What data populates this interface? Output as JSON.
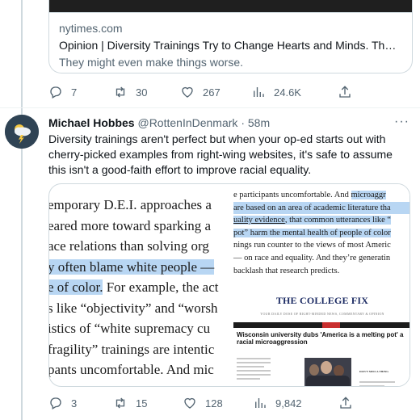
{
  "tweet1": {
    "card": {
      "domain": "nytimes.com",
      "title": "Opinion | Diversity Trainings Try to Change Hearts and Minds. That's a…",
      "description": "They might even make things worse."
    },
    "actions": {
      "replies": "7",
      "retweets": "30",
      "likes": "267",
      "views": "24.6K"
    }
  },
  "tweet2": {
    "author": {
      "name": "Michael Hobbes",
      "handle": "@RottenInDenmark",
      "separator": "·",
      "time": "58m"
    },
    "more_label": "···",
    "text": "Diversity trainings aren't perfect but when your op-ed starts out with cherry-picked examples from right-wing websites, it's safe to assume this isn't a good-faith effort to improve racial equality.",
    "media_left": {
      "lines": [
        "emporary D.E.I. approaches a",
        "eared more toward sparking a",
        "ace relations than solving org",
        "y often blame white people —",
        "e of color. For example, the act",
        "s like “objectivity” and “worsh",
        "istics of “white supremacy cu",
        "fragility” trainings are intentic",
        "pants uncomfortable. And mic"
      ],
      "highlight_line3": "y often blame white people —",
      "highlight_line4": "e of color."
    },
    "media_right": {
      "line1_a": "e participants uncomfortable. And ",
      "line1_b": "microaggr",
      "line2": "are based on an area of academic literature tha",
      "line3_a": "uality evidence",
      "line3_b": ", that common utterances like “",
      "line4_a": "pot”",
      "line4_b": " harm the mental health of people of color",
      "line5": "nings run counter to the views of most Americ",
      "line6": "— on race and equality. And they’re generatin",
      "line7": "backlash that research predicts.",
      "screenshot": {
        "logo": "THE COLLEGE FIX",
        "tagline": "YOUR DAILY DOSE OF RIGHT-MINDED NEWS, COMMENTARY & OPINION",
        "title": "Wisconsin university dubs 'America is a melting pot' a racial microaggression",
        "side_title": "DON'T MISS A THING"
      }
    },
    "actions": {
      "replies": "3",
      "retweets": "15",
      "likes": "128",
      "views": "9,842"
    }
  }
}
